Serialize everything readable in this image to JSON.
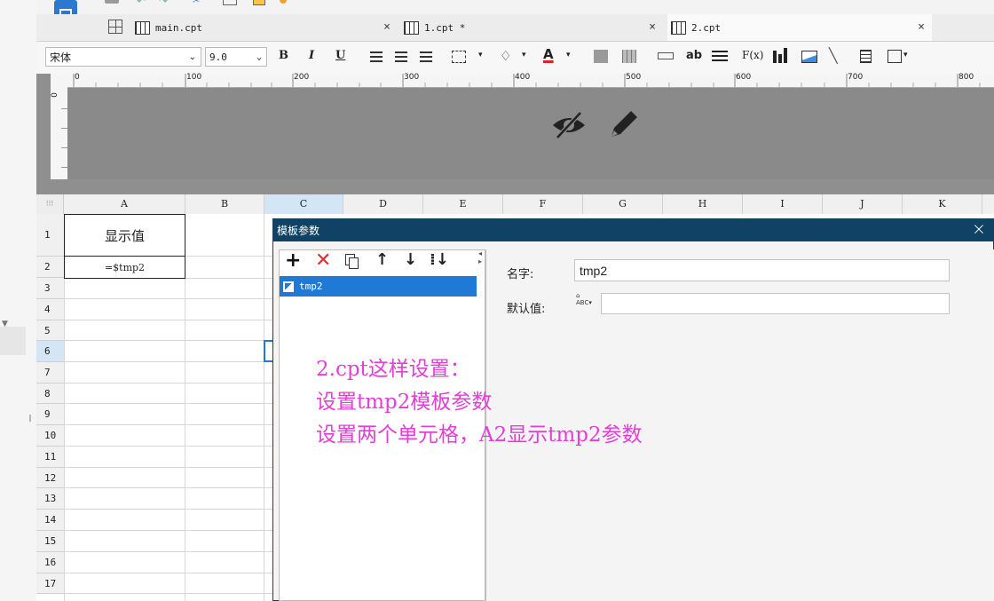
{
  "tabs": [
    {
      "label": "main.cpt"
    },
    {
      "label": "1.cpt *"
    },
    {
      "label": "2.cpt"
    }
  ],
  "font": {
    "family": "宋体",
    "size": "9.0"
  },
  "format_buttons": {
    "bold": "B",
    "italic": "I",
    "underline": "U",
    "text_ab": "ab",
    "formula": "F(x)"
  },
  "ruler_ticks": [
    "0",
    "100",
    "200",
    "300",
    "400",
    "500",
    "600",
    "700",
    "800"
  ],
  "columns": [
    "A",
    "B",
    "C",
    "D",
    "E",
    "F",
    "G",
    "H",
    "I",
    "J",
    "K"
  ],
  "rows": [
    "1",
    "2",
    "3",
    "4",
    "5",
    "6",
    "7",
    "8",
    "9",
    "10",
    "11",
    "12",
    "13",
    "14",
    "15",
    "16",
    "17"
  ],
  "cells": {
    "A1": "显示值",
    "A2": "=$tmp2"
  },
  "dialog": {
    "title": "模板参数",
    "close": "×",
    "params": [
      {
        "name": "tmp2"
      }
    ],
    "name_label": "名字:",
    "name_value": "tmp2",
    "default_label": "默认值:",
    "default_value": ""
  },
  "annotation": {
    "line1": "2.cpt这样设置：",
    "line2": "设置tmp2模板参数",
    "line3": "设置两个单元格，A2显示tmp2参数"
  },
  "colors": {
    "dialog_title": "#0f4264",
    "annotation": "#e33fd6",
    "selected_item": "#1e7ad6"
  }
}
